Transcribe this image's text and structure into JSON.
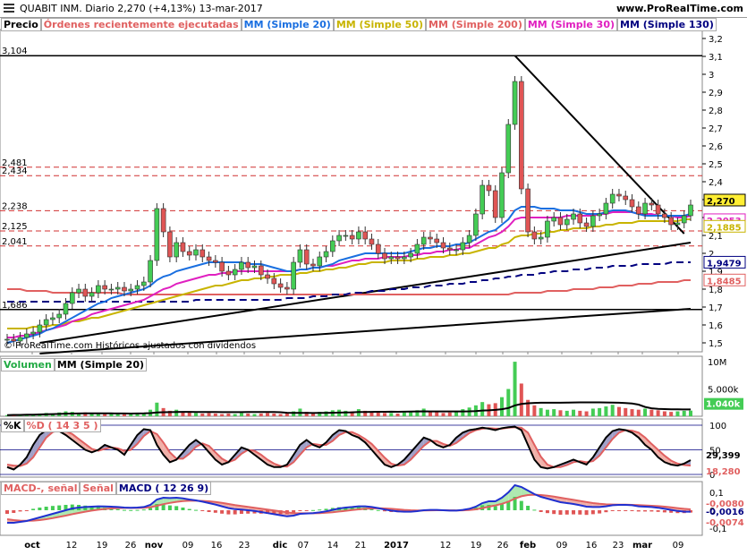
{
  "header": {
    "title": "QUABIT INM.   Diario   2,270 (+4,13%)   13-mar-2017",
    "url": "www.ProRealTime.com"
  },
  "price_legend": [
    "Precio",
    "Órdenes recientemente ejecutadas",
    "MM (Simple 20)",
    "MM (Simple 50)",
    "MM (Simple 200)",
    "MM (Simple 30)",
    "MM (Simple 130)"
  ],
  "legend_colors": [
    "#000000",
    "#e06060",
    "#1a6fe0",
    "#c8b400",
    "#e06060",
    "#e020c0",
    "#000080"
  ],
  "volume_legend": [
    "Volumen",
    "MM (Simple 20)"
  ],
  "stoch_legend": [
    "%K",
    "%D ( 14 3 5 )"
  ],
  "macd_legend": [
    "MACD-, señal",
    "Señal",
    "MACD ( 12 26 9)"
  ],
  "credit": "© ProRealTime.com  Históricos ajustados con dividendos",
  "left_levels": [
    "3,104",
    "2,481",
    "2,434",
    "2,238",
    "2,125",
    "2,041",
    "1,686"
  ],
  "chart_data": {
    "type": "line",
    "title": "QUABIT INM. Diario",
    "last_price": "2,270",
    "change": "+4,13%",
    "date": "13-mar-2017",
    "x_tick_labels": [
      "oct",
      "12",
      "19",
      "26",
      "nov",
      "09",
      "16",
      "23",
      "dic",
      "07",
      "14",
      "21",
      "2017",
      "12",
      "19",
      "26",
      "feb",
      "09",
      "16",
      "23",
      "mar",
      "09"
    ],
    "price_axis": [
      "3,2",
      "3,1",
      "3",
      "2,9",
      "2,8",
      "2,7",
      "2,6",
      "2,5",
      "2,4",
      "2,3",
      "2,2",
      "2,1",
      "2",
      "1,9",
      "1,8",
      "1,7",
      "1,6",
      "1,5"
    ],
    "price_range": [
      1.45,
      3.25
    ],
    "horizontal_levels": [
      3.104,
      2.481,
      2.434,
      2.238,
      2.125,
      2.041,
      1.686
    ],
    "price_badges": {
      "price": "2,270",
      "mm30": "2,2053",
      "mm50": "2,1885",
      "mm130": "1,9479",
      "mm200": "1,8485"
    },
    "close": [
      1.52,
      1.51,
      1.53,
      1.55,
      1.56,
      1.6,
      1.63,
      1.64,
      1.66,
      1.72,
      1.78,
      1.8,
      1.76,
      1.78,
      1.82,
      1.8,
      1.8,
      1.81,
      1.79,
      1.8,
      1.82,
      1.84,
      1.96,
      2.25,
      2.12,
      1.98,
      2.06,
      2.01,
      1.99,
      2.02,
      1.98,
      1.96,
      1.95,
      1.9,
      1.88,
      1.91,
      1.95,
      1.92,
      1.93,
      1.88,
      1.86,
      1.83,
      1.81,
      1.8,
      1.95,
      2.02,
      1.94,
      1.93,
      1.98,
      2.01,
      2.07,
      2.1,
      2.1,
      2.08,
      2.12,
      2.08,
      2.05,
      2.0,
      1.97,
      1.98,
      1.97,
      1.98,
      2.0,
      2.05,
      2.09,
      2.08,
      2.06,
      2.03,
      2.02,
      2.02,
      2.06,
      2.1,
      2.22,
      2.38,
      2.35,
      2.2,
      2.45,
      2.72,
      2.96,
      2.36,
      2.12,
      2.08,
      2.09,
      2.18,
      2.2,
      2.16,
      2.19,
      2.22,
      2.17,
      2.15,
      2.21,
      2.22,
      2.28,
      2.33,
      2.32,
      2.3,
      2.26,
      2.22,
      2.28,
      2.27,
      2.22,
      2.2,
      2.16,
      2.17,
      2.21,
      2.27
    ],
    "mm20": [
      1.5,
      1.51,
      1.52,
      1.53,
      1.54,
      1.55,
      1.57,
      1.58,
      1.6,
      1.62,
      1.64,
      1.66,
      1.68,
      1.7,
      1.72,
      1.73,
      1.75,
      1.76,
      1.77,
      1.78,
      1.79,
      1.8,
      1.82,
      1.85,
      1.87,
      1.88,
      1.9,
      1.91,
      1.92,
      1.93,
      1.94,
      1.95,
      1.95,
      1.95,
      1.95,
      1.95,
      1.95,
      1.94,
      1.94,
      1.94,
      1.93,
      1.92,
      1.91,
      1.9,
      1.9,
      1.91,
      1.91,
      1.92,
      1.92,
      1.93,
      1.94,
      1.96,
      1.97,
      1.98,
      1.99,
      2.0,
      2.0,
      2.0,
      2.0,
      2.0,
      2.0,
      2.0,
      2.01,
      2.02,
      2.03,
      2.03,
      2.04,
      2.04,
      2.04,
      2.05,
      2.05,
      2.06,
      2.08,
      2.1,
      2.12,
      2.13,
      2.16,
      2.19,
      2.24,
      2.26,
      2.26,
      2.26,
      2.25,
      2.25,
      2.25,
      2.24,
      2.24,
      2.24,
      2.23,
      2.22,
      2.22,
      2.22,
      2.23,
      2.24,
      2.24,
      2.24,
      2.23,
      2.22,
      2.21,
      2.21,
      2.21,
      2.21,
      2.21,
      2.21,
      2.21,
      2.22
    ],
    "mm50": [
      1.58,
      1.58,
      1.58,
      1.58,
      1.59,
      1.59,
      1.59,
      1.6,
      1.6,
      1.61,
      1.62,
      1.62,
      1.63,
      1.64,
      1.64,
      1.65,
      1.66,
      1.67,
      1.68,
      1.69,
      1.7,
      1.71,
      1.72,
      1.73,
      1.74,
      1.75,
      1.76,
      1.77,
      1.78,
      1.79,
      1.8,
      1.81,
      1.82,
      1.82,
      1.83,
      1.84,
      1.85,
      1.85,
      1.86,
      1.86,
      1.87,
      1.87,
      1.88,
      1.88,
      1.88,
      1.89,
      1.89,
      1.9,
      1.9,
      1.91,
      1.91,
      1.92,
      1.92,
      1.93,
      1.94,
      1.94,
      1.95,
      1.95,
      1.95,
      1.96,
      1.96,
      1.96,
      1.96,
      1.97,
      1.97,
      1.98,
      1.98,
      1.98,
      1.99,
      1.99,
      2.0,
      2.0,
      2.01,
      2.02,
      2.03,
      2.03,
      2.05,
      2.06,
      2.09,
      2.1,
      2.1,
      2.11,
      2.11,
      2.12,
      2.12,
      2.13,
      2.13,
      2.14,
      2.14,
      2.14,
      2.15,
      2.15,
      2.16,
      2.16,
      2.17,
      2.17,
      2.17,
      2.18,
      2.18,
      2.18,
      2.18,
      2.18,
      2.18,
      2.18,
      2.19,
      2.19
    ],
    "mm30": [
      1.53,
      1.53,
      1.54,
      1.54,
      1.55,
      1.56,
      1.57,
      1.58,
      1.59,
      1.6,
      1.62,
      1.63,
      1.64,
      1.66,
      1.67,
      1.68,
      1.69,
      1.7,
      1.71,
      1.72,
      1.73,
      1.74,
      1.76,
      1.78,
      1.8,
      1.81,
      1.83,
      1.84,
      1.85,
      1.86,
      1.87,
      1.88,
      1.88,
      1.89,
      1.89,
      1.9,
      1.9,
      1.9,
      1.9,
      1.9,
      1.9,
      1.9,
      1.9,
      1.9,
      1.9,
      1.91,
      1.91,
      1.92,
      1.92,
      1.93,
      1.93,
      1.94,
      1.95,
      1.96,
      1.96,
      1.97,
      1.97,
      1.97,
      1.98,
      1.98,
      1.98,
      1.98,
      1.99,
      1.99,
      2.0,
      2.0,
      2.01,
      2.01,
      2.02,
      2.02,
      2.03,
      2.03,
      2.05,
      2.07,
      2.09,
      2.1,
      2.12,
      2.15,
      2.19,
      2.2,
      2.2,
      2.2,
      2.2,
      2.2,
      2.2,
      2.2,
      2.21,
      2.21,
      2.21,
      2.21,
      2.21,
      2.22,
      2.22,
      2.23,
      2.23,
      2.23,
      2.23,
      2.22,
      2.22,
      2.22,
      2.21,
      2.21,
      2.21,
      2.2,
      2.2,
      2.21
    ],
    "mm130": [
      1.73,
      1.73,
      1.73,
      1.73,
      1.73,
      1.73,
      1.73,
      1.73,
      1.73,
      1.73,
      1.73,
      1.73,
      1.73,
      1.73,
      1.73,
      1.73,
      1.73,
      1.73,
      1.73,
      1.73,
      1.73,
      1.73,
      1.73,
      1.73,
      1.73,
      1.73,
      1.73,
      1.73,
      1.73,
      1.74,
      1.74,
      1.74,
      1.74,
      1.74,
      1.74,
      1.74,
      1.74,
      1.74,
      1.74,
      1.74,
      1.74,
      1.74,
      1.74,
      1.75,
      1.75,
      1.75,
      1.75,
      1.76,
      1.76,
      1.76,
      1.77,
      1.77,
      1.77,
      1.78,
      1.78,
      1.78,
      1.79,
      1.79,
      1.79,
      1.8,
      1.8,
      1.8,
      1.81,
      1.81,
      1.81,
      1.82,
      1.82,
      1.82,
      1.83,
      1.83,
      1.83,
      1.84,
      1.84,
      1.85,
      1.85,
      1.86,
      1.86,
      1.87,
      1.87,
      1.88,
      1.88,
      1.88,
      1.89,
      1.89,
      1.9,
      1.9,
      1.9,
      1.91,
      1.91,
      1.91,
      1.92,
      1.92,
      1.92,
      1.93,
      1.93,
      1.93,
      1.93,
      1.94,
      1.94,
      1.94,
      1.94,
      1.94,
      1.95,
      1.95,
      1.95,
      1.95
    ],
    "mm200": [
      1.8,
      1.8,
      1.8,
      1.79,
      1.79,
      1.79,
      1.79,
      1.78,
      1.78,
      1.78,
      1.78,
      1.78,
      1.78,
      1.78,
      1.78,
      1.78,
      1.78,
      1.78,
      1.77,
      1.77,
      1.77,
      1.77,
      1.77,
      1.77,
      1.77,
      1.77,
      1.77,
      1.77,
      1.77,
      1.77,
      1.77,
      1.77,
      1.77,
      1.77,
      1.77,
      1.77,
      1.77,
      1.77,
      1.77,
      1.77,
      1.77,
      1.77,
      1.77,
      1.77,
      1.77,
      1.77,
      1.77,
      1.77,
      1.77,
      1.77,
      1.77,
      1.77,
      1.77,
      1.77,
      1.77,
      1.77,
      1.77,
      1.77,
      1.77,
      1.77,
      1.77,
      1.77,
      1.77,
      1.77,
      1.77,
      1.77,
      1.77,
      1.77,
      1.77,
      1.77,
      1.77,
      1.77,
      1.77,
      1.77,
      1.77,
      1.77,
      1.77,
      1.77,
      1.78,
      1.78,
      1.78,
      1.78,
      1.78,
      1.79,
      1.79,
      1.79,
      1.79,
      1.8,
      1.8,
      1.8,
      1.8,
      1.81,
      1.81,
      1.81,
      1.82,
      1.82,
      1.82,
      1.83,
      1.83,
      1.83,
      1.84,
      1.84,
      1.84,
      1.84,
      1.85,
      1.85
    ],
    "volume_axis": [
      "10M",
      "5.000k"
    ],
    "volume_badge": "1.040k",
    "volume_mil": [
      200,
      300,
      250,
      350,
      400,
      500,
      600,
      500,
      700,
      900,
      800,
      600,
      700,
      500,
      600,
      400,
      500,
      400,
      350,
      400,
      500,
      600,
      1200,
      2500,
      1500,
      1000,
      1200,
      800,
      700,
      600,
      500,
      600,
      500,
      400,
      500,
      400,
      600,
      500,
      400,
      500,
      600,
      500,
      400,
      500,
      900,
      1400,
      800,
      600,
      800,
      900,
      1100,
      1200,
      1000,
      900,
      1300,
      1000,
      800,
      700,
      600,
      600,
      500,
      700,
      800,
      1100,
      1400,
      900,
      800,
      600,
      700,
      900,
      1300,
      1600,
      2000,
      2600,
      2200,
      2400,
      3500,
      5000,
      10000,
      6000,
      3000,
      2000,
      1500,
      1200,
      1300,
      1100,
      1000,
      1200,
      1000,
      900,
      1400,
      1500,
      1800,
      2100,
      1700,
      1500,
      1300,
      1200,
      1400,
      1200,
      1100,
      900,
      800,
      900,
      1000,
      1040
    ],
    "stoch_axis": [
      "100",
      "50",
      "0"
    ],
    "stoch_badges": {
      "k": "29,399",
      "d": "18,280"
    },
    "stoch_k": [
      15,
      10,
      20,
      35,
      60,
      80,
      90,
      92,
      88,
      80,
      70,
      60,
      50,
      45,
      50,
      60,
      55,
      50,
      40,
      60,
      80,
      92,
      90,
      60,
      40,
      25,
      30,
      45,
      60,
      70,
      60,
      45,
      30,
      20,
      25,
      40,
      55,
      50,
      40,
      30,
      20,
      15,
      15,
      20,
      40,
      60,
      70,
      60,
      55,
      65,
      80,
      90,
      88,
      80,
      75,
      65,
      50,
      35,
      20,
      15,
      20,
      30,
      45,
      60,
      75,
      70,
      60,
      55,
      60,
      75,
      85,
      90,
      92,
      95,
      93,
      90,
      94,
      96,
      97,
      90,
      60,
      30,
      15,
      12,
      15,
      20,
      25,
      30,
      25,
      20,
      35,
      55,
      75,
      88,
      92,
      90,
      85,
      75,
      60,
      50,
      35,
      25,
      20,
      18,
      22,
      29
    ],
    "stoch_d": [
      20,
      18,
      17,
      22,
      35,
      55,
      75,
      86,
      90,
      88,
      82,
      72,
      62,
      52,
      48,
      52,
      55,
      53,
      48,
      50,
      62,
      78,
      88,
      82,
      65,
      45,
      32,
      32,
      42,
      56,
      63,
      58,
      45,
      32,
      25,
      30,
      42,
      50,
      48,
      40,
      30,
      22,
      17,
      16,
      25,
      40,
      55,
      62,
      60,
      60,
      68,
      80,
      86,
      86,
      80,
      72,
      62,
      48,
      34,
      22,
      18,
      20,
      30,
      44,
      58,
      68,
      68,
      62,
      58,
      64,
      74,
      84,
      90,
      93,
      94,
      93,
      93,
      95,
      96,
      95,
      85,
      60,
      36,
      20,
      15,
      15,
      19,
      25,
      27,
      25,
      27,
      38,
      55,
      72,
      85,
      90,
      89,
      85,
      75,
      62,
      50,
      38,
      28,
      22,
      19,
      18
    ],
    "macd_axis": [
      "0,1",
      "0",
      "-0,1"
    ],
    "macd_badges": {
      "macd": "-0,0080",
      "signal": "-0,0016",
      "hist": "-0,0074"
    },
    "macd": [
      -0.07,
      -0.07,
      -0.065,
      -0.06,
      -0.05,
      -0.04,
      -0.03,
      -0.02,
      -0.01,
      0.0,
      0.01,
      0.015,
      0.018,
      0.02,
      0.022,
      0.021,
      0.02,
      0.018,
      0.015,
      0.014,
      0.015,
      0.018,
      0.03,
      0.06,
      0.07,
      0.068,
      0.07,
      0.066,
      0.06,
      0.055,
      0.048,
      0.04,
      0.032,
      0.022,
      0.012,
      0.006,
      0.004,
      0.0,
      -0.004,
      -0.01,
      -0.016,
      -0.022,
      -0.028,
      -0.034,
      -0.03,
      -0.02,
      -0.018,
      -0.016,
      -0.012,
      -0.006,
      0.002,
      0.01,
      0.015,
      0.018,
      0.022,
      0.022,
      0.018,
      0.012,
      0.004,
      -0.002,
      -0.006,
      -0.008,
      -0.008,
      -0.005,
      0.0,
      0.002,
      0.002,
      0.0,
      -0.002,
      -0.002,
      0.002,
      0.008,
      0.02,
      0.04,
      0.05,
      0.05,
      0.07,
      0.1,
      0.14,
      0.13,
      0.11,
      0.09,
      0.075,
      0.065,
      0.055,
      0.045,
      0.04,
      0.035,
      0.028,
      0.02,
      0.018,
      0.018,
      0.022,
      0.028,
      0.03,
      0.03,
      0.028,
      0.022,
      0.02,
      0.018,
      0.014,
      0.008,
      0.002,
      -0.004,
      -0.008,
      -0.008
    ],
    "macd_signal": [
      -0.05,
      -0.055,
      -0.058,
      -0.059,
      -0.058,
      -0.055,
      -0.05,
      -0.044,
      -0.037,
      -0.03,
      -0.022,
      -0.015,
      -0.008,
      -0.002,
      0.003,
      0.007,
      0.01,
      0.012,
      0.013,
      0.013,
      0.013,
      0.014,
      0.017,
      0.025,
      0.034,
      0.041,
      0.047,
      0.051,
      0.053,
      0.053,
      0.052,
      0.05,
      0.046,
      0.041,
      0.035,
      0.029,
      0.024,
      0.019,
      0.014,
      0.009,
      0.004,
      -0.001,
      -0.006,
      -0.012,
      -0.016,
      -0.017,
      -0.017,
      -0.017,
      -0.016,
      -0.014,
      -0.011,
      -0.007,
      -0.003,
      0.001,
      0.005,
      0.008,
      0.01,
      0.011,
      0.01,
      0.008,
      0.005,
      0.002,
      0.0,
      -0.001,
      -0.001,
      -0.0005,
      0.0,
      0.0,
      -0.0005,
      -0.001,
      -0.0005,
      0.001,
      0.005,
      0.012,
      0.02,
      0.027,
      0.036,
      0.048,
      0.065,
      0.078,
      0.085,
      0.087,
      0.085,
      0.081,
      0.076,
      0.07,
      0.064,
      0.058,
      0.052,
      0.046,
      0.04,
      0.036,
      0.033,
      0.032,
      0.031,
      0.031,
      0.03,
      0.029,
      0.027,
      0.025,
      0.023,
      0.02,
      0.016,
      0.012,
      0.008,
      0.005
    ]
  }
}
